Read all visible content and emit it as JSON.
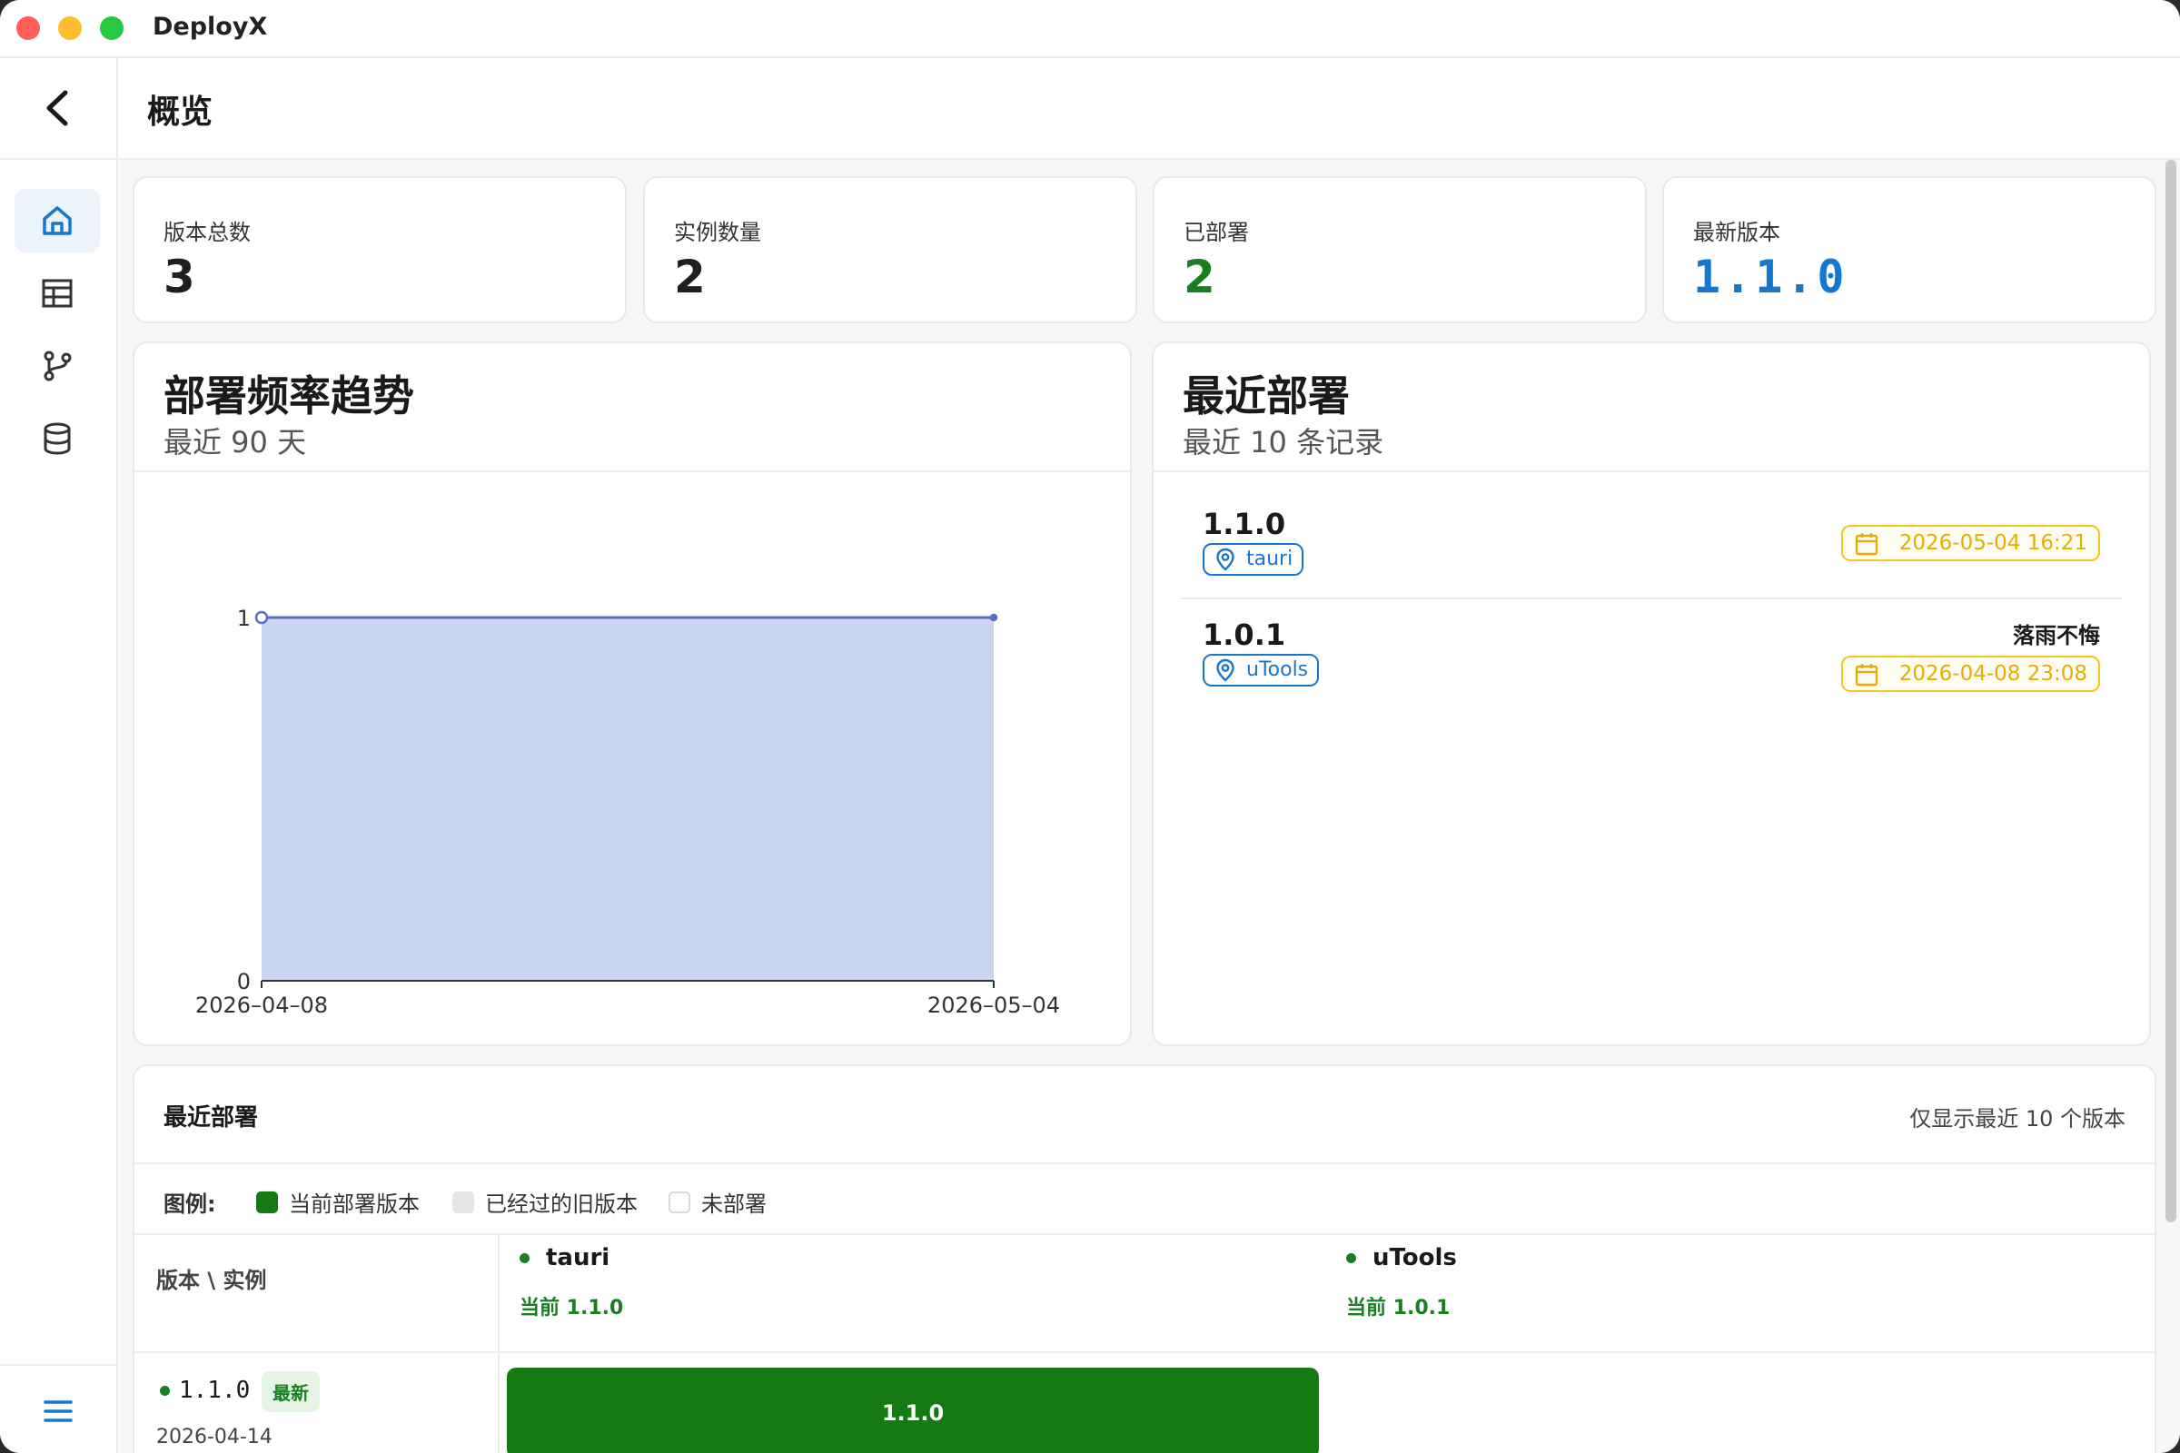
{
  "app": {
    "title": "DeployX"
  },
  "header": {
    "title": "概览"
  },
  "sidebar": {
    "items": [
      "home-icon",
      "table-icon",
      "branch-icon",
      "database-icon"
    ],
    "active": 0
  },
  "stats": [
    {
      "label": "版本总数",
      "value": "3"
    },
    {
      "label": "实例数量",
      "value": "2"
    },
    {
      "label": "已部署",
      "value": "2"
    },
    {
      "label": "最新版本",
      "value": "1.1.0"
    }
  ],
  "trend": {
    "title": "部署频率趋势",
    "subtitle": "最近 90 天",
    "chart_data": {
      "type": "area",
      "x": [
        "2026-04-08",
        "2026-05-04"
      ],
      "y": [
        1,
        1
      ],
      "ylim": [
        0,
        1
      ],
      "y_ticks": [
        "0",
        "1"
      ],
      "x_ticks": [
        "2026–04–08",
        "2026–05–04"
      ],
      "grid": false,
      "fill_color": "#cbd5f3",
      "line_color": "#5470c6"
    }
  },
  "recent": {
    "title": "最近部署",
    "subtitle": "最近 10 条记录",
    "items": [
      {
        "version": "1.1.0",
        "instance": "tauri",
        "author": "",
        "date": "2026-05-04 16:21"
      },
      {
        "version": "1.0.1",
        "instance": "uTools",
        "author": "落雨不悔",
        "date": "2026-04-08 23:08"
      }
    ]
  },
  "matrix": {
    "title": "最近部署",
    "note": "仅显示最近 10 个版本",
    "legend_label": "图例:",
    "legend": [
      {
        "label": "当前部署版本",
        "color": "#157a13"
      },
      {
        "label": "已经过的旧版本",
        "color": "#e6e6e6"
      },
      {
        "label": "未部署",
        "color": "#ffffff"
      }
    ],
    "corner": "版本 \\ 实例",
    "columns": [
      {
        "name": "tauri",
        "current": "当前 1.1.0"
      },
      {
        "name": "uTools",
        "current": "当前 1.0.1"
      }
    ],
    "rows": [
      {
        "version": "1.1.0",
        "badge": "最新",
        "date": "2026-04-14",
        "cell": "1.1.0"
      }
    ]
  },
  "colors": {
    "accent": "#1677cc",
    "success": "#1a7f20",
    "warning": "#f5c518"
  }
}
